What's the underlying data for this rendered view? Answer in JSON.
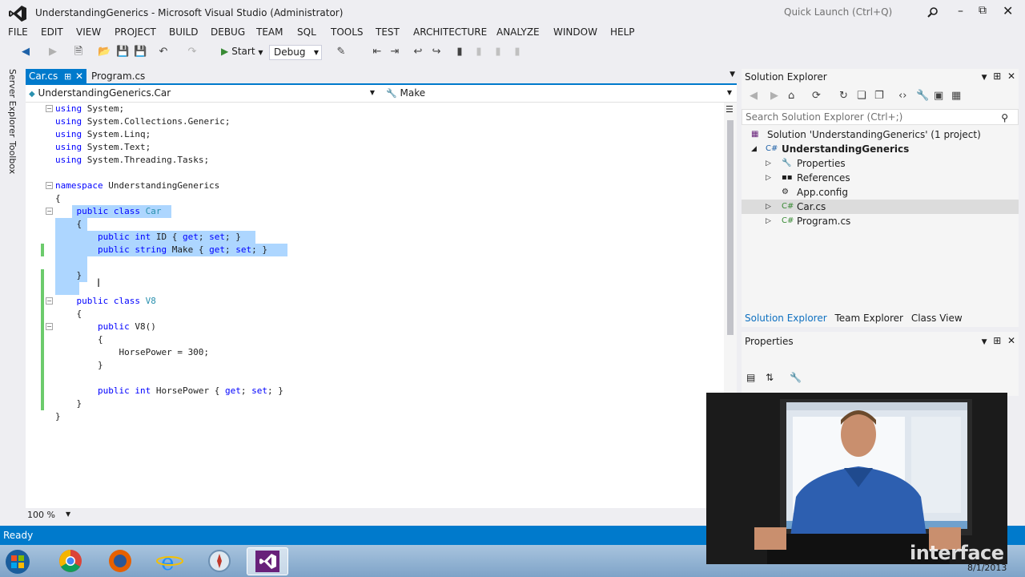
{
  "window": {
    "title": "UnderstandingGenerics - Microsoft Visual Studio (Administrator)",
    "quick_launch": "Quick Launch (Ctrl+Q)"
  },
  "menu": [
    "FILE",
    "EDIT",
    "VIEW",
    "PROJECT",
    "BUILD",
    "DEBUG",
    "TEAM",
    "SQL",
    "TOOLS",
    "TEST",
    "ARCHITECTURE",
    "ANALYZE",
    "WINDOW",
    "HELP"
  ],
  "toolbar": {
    "start_label": "Start",
    "configuration": "Debug"
  },
  "side_tabs": [
    "Server Explorer",
    "Toolbox"
  ],
  "doc_tabs": [
    {
      "label": "Car.cs",
      "active": true
    },
    {
      "label": "Program.cs",
      "active": false
    }
  ],
  "navbar": {
    "type": "UnderstandingGenerics.Car",
    "member": "Make"
  },
  "code": [
    "using System;",
    "using System.Collections.Generic;",
    "using System.Linq;",
    "using System.Text;",
    "using System.Threading.Tasks;",
    "",
    "namespace UnderstandingGenerics",
    "{",
    "    public class Car",
    "    {",
    "        public int ID { get; set; }",
    "        public string Make { get; set; }",
    "",
    "    }",
    "",
    "    public class V8",
    "    {",
    "        public V8()",
    "        {",
    "            HorsePower = 300;",
    "        }",
    "",
    "        public int HorsePower { get; set; }",
    "    }",
    "}"
  ],
  "editor": {
    "zoom": "100 %"
  },
  "solution_explorer": {
    "title": "Solution Explorer",
    "search_placeholder": "Search Solution Explorer (Ctrl+;)",
    "tree": [
      {
        "label": "Solution 'UnderstandingGenerics' (1 project)",
        "level": 0
      },
      {
        "label": "UnderstandingGenerics",
        "level": 1,
        "bold": true
      },
      {
        "label": "Properties",
        "level": 2
      },
      {
        "label": "References",
        "level": 2
      },
      {
        "label": "App.config",
        "level": 2
      },
      {
        "label": "Car.cs",
        "level": 2,
        "selected": true
      },
      {
        "label": "Program.cs",
        "level": 2
      }
    ],
    "tabs": [
      "Solution Explorer",
      "Team Explorer",
      "Class View"
    ]
  },
  "properties": {
    "title": "Properties"
  },
  "status": {
    "text": "Ready"
  },
  "taskbar": {
    "date": "8/1/2013"
  },
  "video": {
    "watermark": "interface"
  },
  "colors": {
    "accent": "#007acc",
    "keyword": "#0000ff",
    "type": "#2b91af",
    "selection": "#add6ff"
  }
}
